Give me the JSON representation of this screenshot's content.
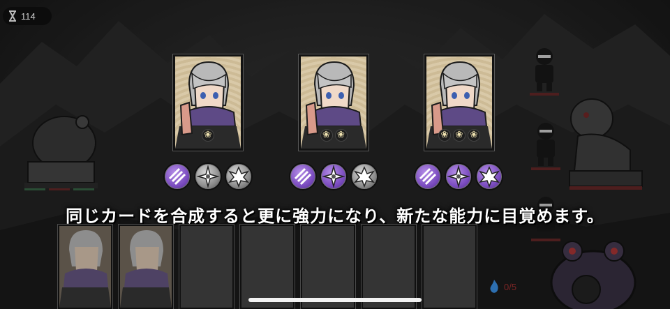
{
  "hud": {
    "timer_value": "114",
    "timer_icon": "hourglass-icon"
  },
  "cards": [
    {
      "name": "ninja-card-1",
      "stars": 1,
      "star_glyph": "❀"
    },
    {
      "name": "ninja-card-2",
      "stars": 2,
      "star_glyph": "❀"
    },
    {
      "name": "ninja-card-3",
      "stars": 3,
      "star_glyph": "❀"
    }
  ],
  "skill_sets": [
    [
      "on",
      "off",
      "off"
    ],
    [
      "on",
      "on",
      "off"
    ],
    [
      "on",
      "on",
      "on"
    ]
  ],
  "skill_icons": [
    "kunai-icon",
    "shuriken-icon",
    "burst-icon"
  ],
  "message": "同じカードを合成すると更に強力になり、新たな能力に目覚めます。",
  "hand": {
    "slots": [
      "filled",
      "filled",
      "empty",
      "empty",
      "empty",
      "empty",
      "empty"
    ]
  },
  "enemy_counter": "0/5",
  "colors": {
    "skill_active": "#7a4bbf",
    "skill_inactive": "#8d8d8d",
    "card_frame": "#121212",
    "message": "#ffffff"
  }
}
